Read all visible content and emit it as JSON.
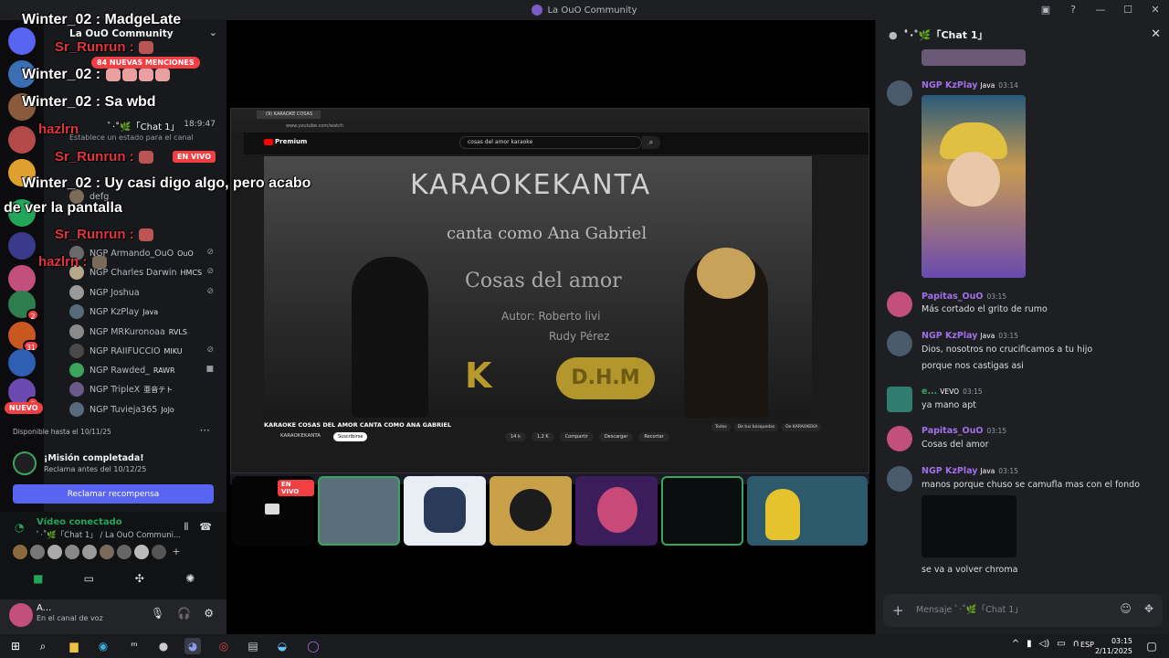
{
  "window": {
    "title": "La OuO Community"
  },
  "left_sidebar": {
    "server_name": "La OuO Community",
    "mentions_badge": "84 NUEVAS MENCIONES",
    "new_badge": "NUEVO",
    "guild_badges": [
      "2",
      "31",
      "9"
    ],
    "chat_channel": "ﾟ·˚🌿「Chat 1」",
    "chat_channel_time": "18:9:47",
    "channel_status": "Establece un estado para el canal",
    "live_label": "EN VIVO",
    "members": [
      {
        "name": "defg",
        "tag": ""
      },
      {
        "name": "NGP Armando_OuO",
        "tag": "OuO"
      },
      {
        "name": "NGP Charles Darwin",
        "tag": "HMCS"
      },
      {
        "name": "NGP Joshua",
        "tag": ""
      },
      {
        "name": "NGP KzPlay",
        "tag": "Java"
      },
      {
        "name": "NGP MRKuronoaa",
        "tag": "RVLS"
      },
      {
        "name": "NGP RAIIFUCCIO",
        "tag": "MIKU"
      },
      {
        "name": "NGP Rawded_",
        "tag": "RAWR"
      },
      {
        "name": "NGP TripleX",
        "tag": "亜音テト"
      },
      {
        "name": "NGP Tuvieja365",
        "tag": "JoJo"
      }
    ],
    "quest": {
      "available_until": "Disponible hasta el 10/11/25",
      "title": "¡Misión completada!",
      "subtitle": "Reclama antes del 10/12/25",
      "claim_button": "Reclamar recompensa"
    },
    "voice": {
      "status": "Vídeo conectado",
      "location": "ﾟ·˚🌿「Chat 1」 / La OuO Communi..."
    },
    "user": {
      "name": "A...",
      "status": "En el canal de voz"
    }
  },
  "overlay_chat": [
    {
      "user": "Winter_02",
      "text": "MadgeLate"
    },
    {
      "user": "Sr_Runrun",
      "text": ""
    },
    {
      "user": "Winter_02",
      "text": ""
    },
    {
      "user": "Winter_02",
      "text": "Sa wbd"
    },
    {
      "user": "hazlrn",
      "text": ""
    },
    {
      "user": "Sr_Runrun",
      "text": ""
    },
    {
      "user": "Winter_02",
      "text": "Uy casi digo algo, pero acabo"
    },
    {
      "user": "",
      "text": "de ver     la pantalla"
    },
    {
      "user": "Sr_Runrun",
      "text": ""
    },
    {
      "user": "hazlrn",
      "text": ""
    }
  ],
  "stream": {
    "browser_tab": "(9) KARAOKE COSAS",
    "browser_url": "www.youtube.com/watch",
    "yt_logo": "Premium",
    "yt_search": "cosas del amor karaoke",
    "video_lines": [
      "KARAOKEKANTA",
      "canta como Ana Gabriel",
      "Cosas del amor",
      "Autor: Roberto livi",
      "Rudy Pérez"
    ],
    "video_logo_kk": "K",
    "video_logo_dhm": "D.H.M",
    "video_title": "KARAOKE COSAS DEL AMOR CANTA COMO ANA GABRIEL",
    "channel_name": "KARAOKEKANTA",
    "subscribe": "Suscribirse",
    "actions": [
      "14 k",
      "1,2 K",
      "Compartir",
      "Descargar",
      "Recortar"
    ],
    "chips": [
      "Todos",
      "De tus búsquedas",
      "De KARAOKEKA"
    ],
    "taskbar_search": "Buscar",
    "tile_live_label": "EN VIVO"
  },
  "chat": {
    "title": "ﾟ·˚🌿「Chat 1」",
    "messages": [
      {
        "user": "NGP KzPlay",
        "badge": "Java",
        "time": "03:14",
        "lines": [],
        "color": "#a070e8"
      },
      {
        "user": "Papitas_OuO",
        "badge": "",
        "time": "03:15",
        "lines": [
          "Más cortado el grito de rumo"
        ],
        "color": "#a070e8"
      },
      {
        "user": "NGP KzPlay",
        "badge": "Java",
        "time": "03:15",
        "lines": [
          "Dios, nosotros no crucificamos a tu hijo",
          "porque nos castigas asi"
        ],
        "color": "#a070e8"
      },
      {
        "user": "e...",
        "badge": "VEVO",
        "time": "03:15",
        "lines": [
          "ya mano apt"
        ],
        "color": "#3ba55d"
      },
      {
        "user": "Papitas_OuO",
        "badge": "",
        "time": "03:15",
        "lines": [
          "Cosas del amor"
        ],
        "color": "#a070e8"
      },
      {
        "user": "NGP KzPlay",
        "badge": "Java",
        "time": "03:15",
        "lines": [
          "manos porque chuso se camufla mas con el fondo"
        ],
        "color": "#a070e8"
      },
      {
        "user": "",
        "badge": "",
        "time": "",
        "lines": [
          "se va a volver chroma"
        ],
        "color": "#a070e8"
      }
    ],
    "composer_placeholder": "Mensaje ﾟ·˚🌿「Chat 1」"
  },
  "taskbar": {
    "lang": "ESP",
    "time": "03:15",
    "date": "2/11/2025"
  }
}
